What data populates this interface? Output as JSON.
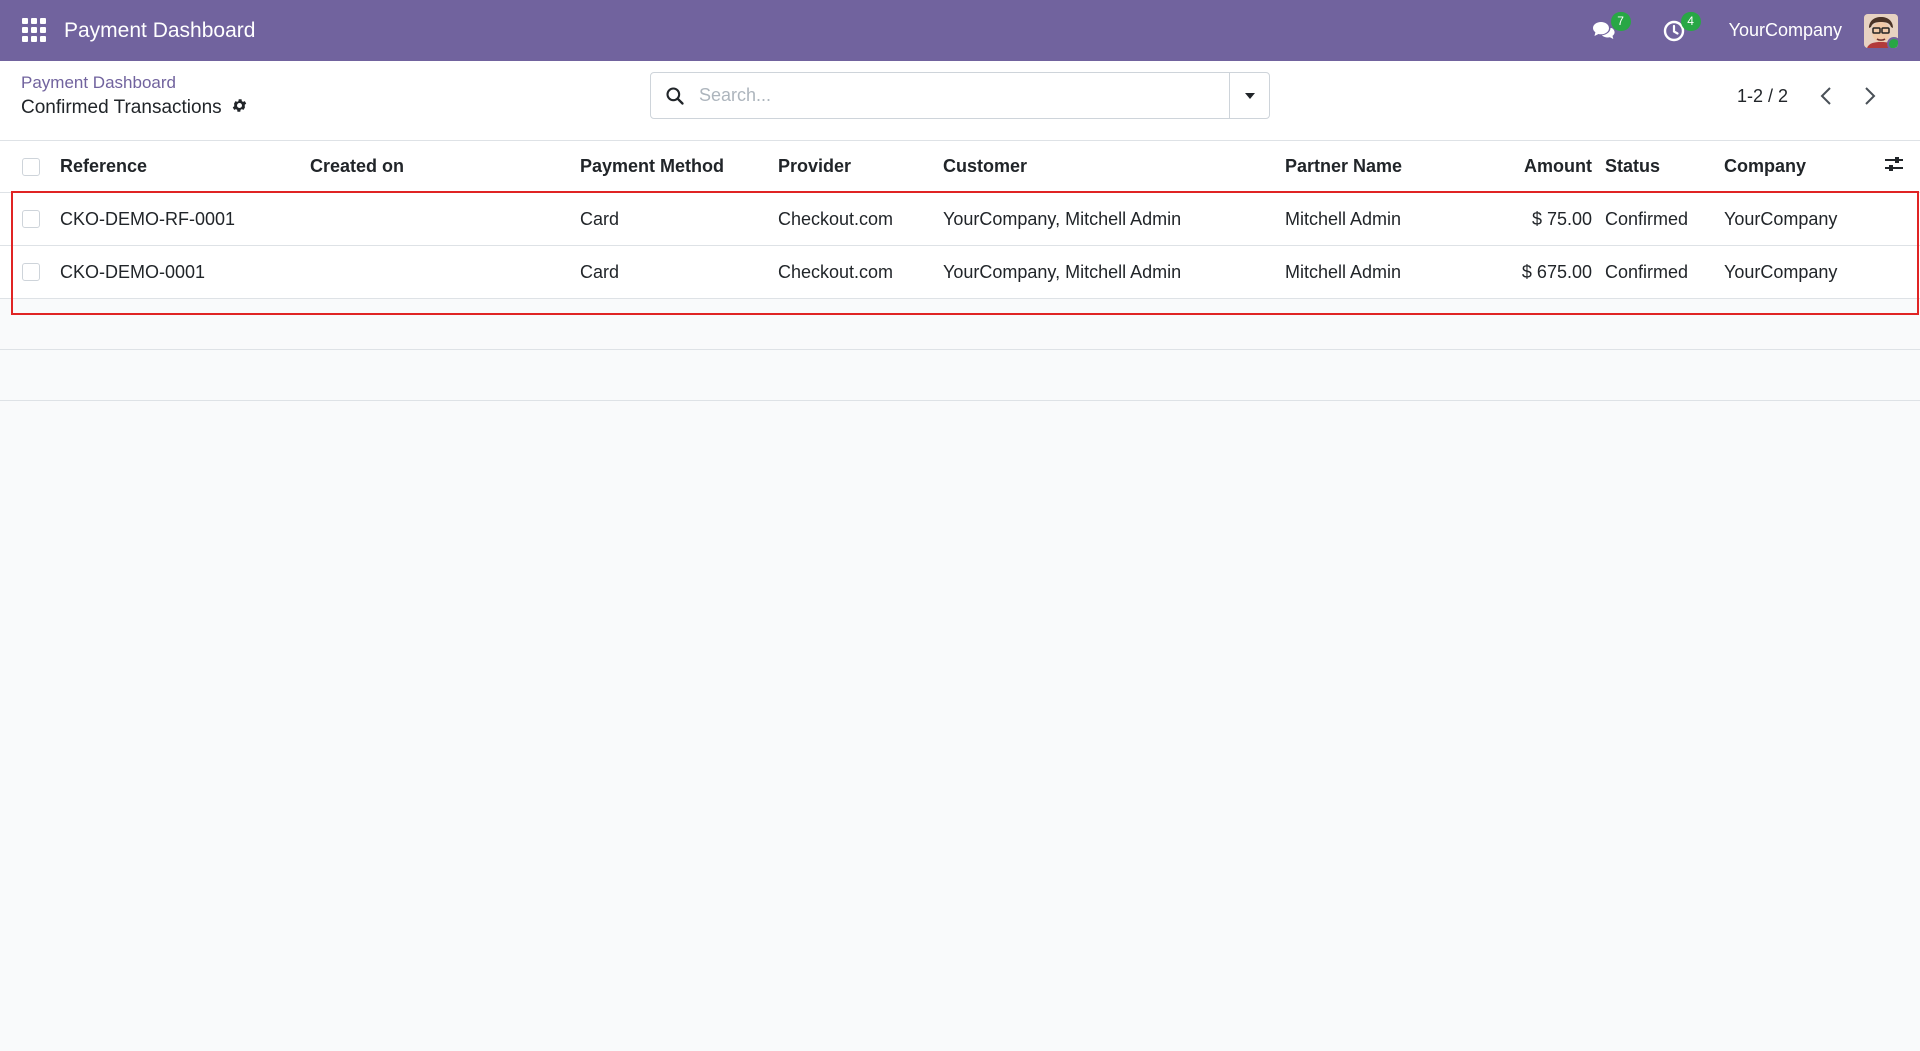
{
  "navbar": {
    "app_title": "Payment Dashboard",
    "messages_count": "7",
    "activities_count": "4",
    "company": "YourCompany",
    "colors": {
      "bg": "#71639e",
      "badge": "#28a745"
    }
  },
  "control_panel": {
    "breadcrumb_parent": "Payment Dashboard",
    "breadcrumb_current": "Confirmed Transactions",
    "search_placeholder": "Search...",
    "pager_value": "1-2 / 2"
  },
  "table": {
    "headers": {
      "reference": "Reference",
      "created_on": "Created on",
      "payment_method": "Payment Method",
      "provider": "Provider",
      "customer": "Customer",
      "partner_name": "Partner Name",
      "amount": "Amount",
      "status": "Status",
      "company": "Company"
    },
    "rows": [
      {
        "reference": "CKO-DEMO-RF-0001",
        "created_on": "",
        "payment_method": "Card",
        "provider": "Checkout.com",
        "customer": "YourCompany, Mitchell Admin",
        "partner_name": "Mitchell Admin",
        "amount": "$ 75.00",
        "status": "Confirmed",
        "company": "YourCompany"
      },
      {
        "reference": "CKO-DEMO-0001",
        "created_on": "",
        "payment_method": "Card",
        "provider": "Checkout.com",
        "customer": "YourCompany, Mitchell Admin",
        "partner_name": "Mitchell Admin",
        "amount": "$ 675.00",
        "status": "Confirmed",
        "company": "YourCompany"
      }
    ]
  },
  "highlight": {
    "color": "#e02424"
  }
}
